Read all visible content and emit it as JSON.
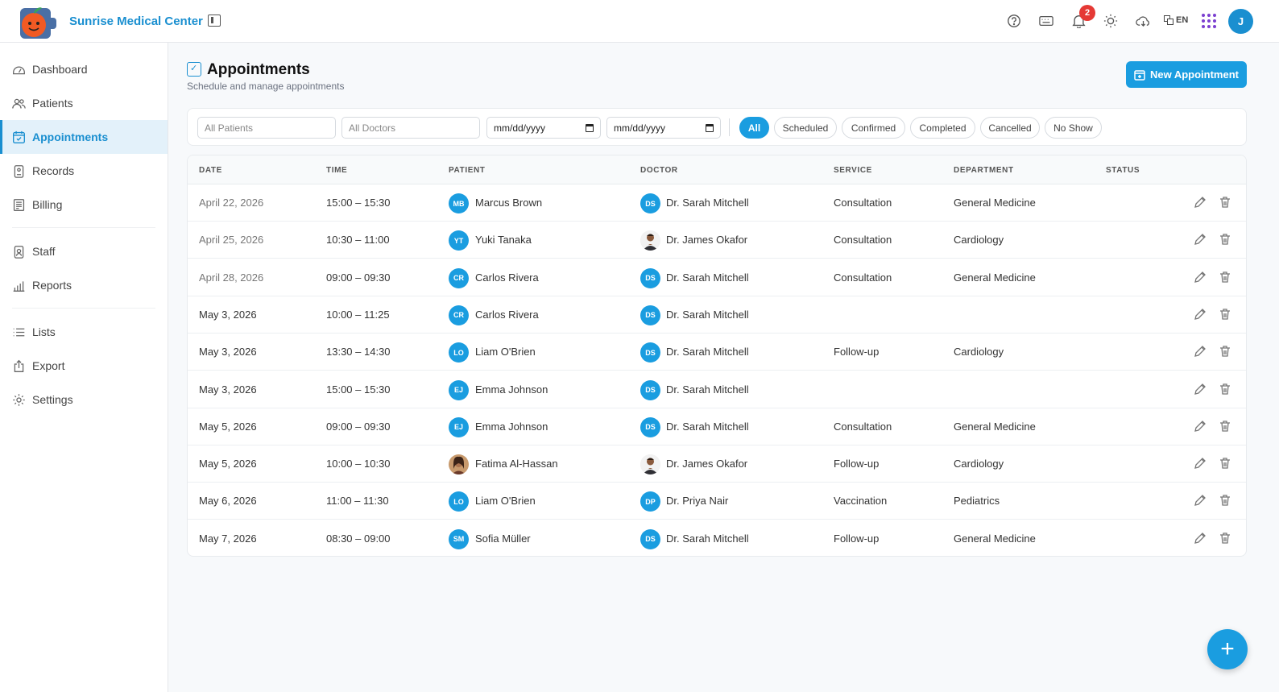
{
  "app": {
    "brand": "Sunrise Medical Center",
    "user_initial": "J",
    "notification_count": "2",
    "language": "EN"
  },
  "sidebar": {
    "items": [
      {
        "label": "Dashboard",
        "icon": "gauge-icon"
      },
      {
        "label": "Patients",
        "icon": "users-icon"
      },
      {
        "label": "Appointments",
        "icon": "calendar-check-icon",
        "active": true
      },
      {
        "label": "Records",
        "icon": "clipboard-icon"
      },
      {
        "label": "Billing",
        "icon": "receipt-icon"
      },
      {
        "label": "Staff",
        "icon": "id-badge-icon"
      },
      {
        "label": "Reports",
        "icon": "bar-chart-icon"
      },
      {
        "label": "Lists",
        "icon": "list-icon"
      },
      {
        "label": "Export",
        "icon": "export-icon"
      },
      {
        "label": "Settings",
        "icon": "gear-icon"
      }
    ]
  },
  "page": {
    "title": "Appointments",
    "subtitle": "Schedule and manage appointments",
    "new_button": "New Appointment"
  },
  "filters": {
    "patients_placeholder": "All Patients",
    "doctors_placeholder": "All Doctors",
    "date_from": "mm/dd/yyyy",
    "date_to": "mm/dd/yyyy",
    "status_chips": [
      "All",
      "Scheduled",
      "Confirmed",
      "Completed",
      "Cancelled",
      "No Show"
    ],
    "active_chip": "All"
  },
  "table": {
    "headers": [
      "DATE",
      "TIME",
      "PATIENT",
      "DOCTOR",
      "SERVICE",
      "DEPARTMENT",
      "STATUS"
    ],
    "rows": [
      {
        "date": "April 22, 2026",
        "time": "15:00 – 15:30",
        "patient": "Marcus Brown",
        "patient_initials": "MB",
        "doctor": "Dr. Sarah Mitchell",
        "doctor_initials": "DS",
        "service": "Consultation",
        "department": "General Medicine",
        "status": "",
        "past": true
      },
      {
        "date": "April 25, 2026",
        "time": "10:30 – 11:00",
        "patient": "Yuki Tanaka",
        "patient_initials": "YT",
        "doctor": "Dr. James Okafor",
        "doctor_initials": "",
        "service": "Consultation",
        "department": "Cardiology",
        "status": "",
        "past": true
      },
      {
        "date": "April 28, 2026",
        "time": "09:00 – 09:30",
        "patient": "Carlos Rivera",
        "patient_initials": "CR",
        "doctor": "Dr. Sarah Mitchell",
        "doctor_initials": "DS",
        "service": "Consultation",
        "department": "General Medicine",
        "status": "",
        "past": true
      },
      {
        "date": "May 3, 2026",
        "time": "10:00 – 11:25",
        "patient": "Carlos Rivera",
        "patient_initials": "CR",
        "doctor": "Dr. Sarah Mitchell",
        "doctor_initials": "DS",
        "service": "",
        "department": "",
        "status": ""
      },
      {
        "date": "May 3, 2026",
        "time": "13:30 – 14:30",
        "patient": "Liam O'Brien",
        "patient_initials": "LO",
        "doctor": "Dr. Sarah Mitchell",
        "doctor_initials": "DS",
        "service": "Follow-up",
        "department": "Cardiology",
        "status": ""
      },
      {
        "date": "May 3, 2026",
        "time": "15:00 – 15:30",
        "patient": "Emma Johnson",
        "patient_initials": "EJ",
        "doctor": "Dr. Sarah Mitchell",
        "doctor_initials": "DS",
        "service": "",
        "department": "",
        "status": ""
      },
      {
        "date": "May 5, 2026",
        "time": "09:00 – 09:30",
        "patient": "Emma Johnson",
        "patient_initials": "EJ",
        "doctor": "Dr. Sarah Mitchell",
        "doctor_initials": "DS",
        "service": "Consultation",
        "department": "General Medicine",
        "status": ""
      },
      {
        "date": "May 5, 2026",
        "time": "10:00 – 10:30",
        "patient": "Fatima Al-Hassan",
        "patient_initials": "",
        "doctor": "Dr. James Okafor",
        "doctor_initials": "",
        "service": "Follow-up",
        "department": "Cardiology",
        "status": ""
      },
      {
        "date": "May 6, 2026",
        "time": "11:00 – 11:30",
        "patient": "Liam O'Brien",
        "patient_initials": "LO",
        "doctor": "Dr. Priya Nair",
        "doctor_initials": "DP",
        "service": "Vaccination",
        "department": "Pediatrics",
        "status": ""
      },
      {
        "date": "May 7, 2026",
        "time": "08:30 – 09:00",
        "patient": "Sofia Müller",
        "patient_initials": "SM",
        "doctor": "Dr. Sarah Mitchell",
        "doctor_initials": "DS",
        "service": "Follow-up",
        "department": "General Medicine",
        "status": ""
      }
    ]
  },
  "fab": {
    "label": "+"
  },
  "colors": {
    "accent": "#1a9de0",
    "brand": "#1a8fd0",
    "badge": "#e53935"
  }
}
